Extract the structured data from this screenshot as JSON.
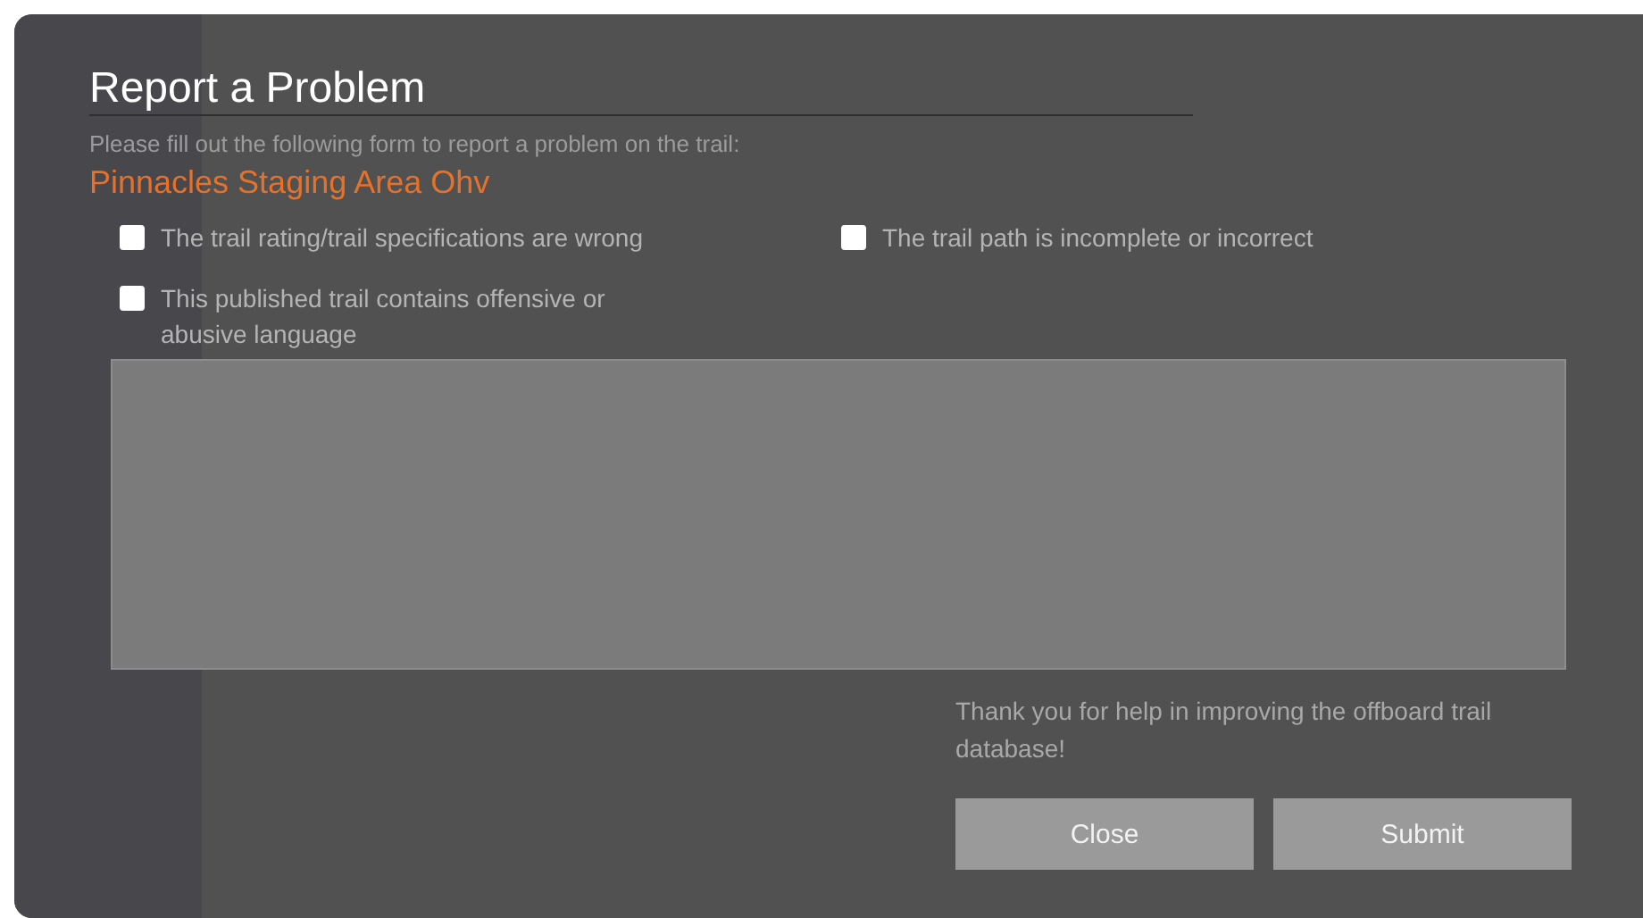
{
  "dialog": {
    "title": "Report a Problem",
    "intro": "Please fill out the following form to report a problem on the trail:",
    "trail_name": "Pinnacles Staging Area Ohv",
    "options": [
      {
        "label": "The trail rating/trail specifications are wrong",
        "checked": false
      },
      {
        "label": "The trail path is incomplete or incorrect",
        "checked": false
      },
      {
        "label": "This published trail contains offensive or abusive language",
        "checked": false
      }
    ],
    "thanks": "Thank you for help in improving the offboard trail database!",
    "buttons": [
      "Close",
      "Submit"
    ]
  }
}
